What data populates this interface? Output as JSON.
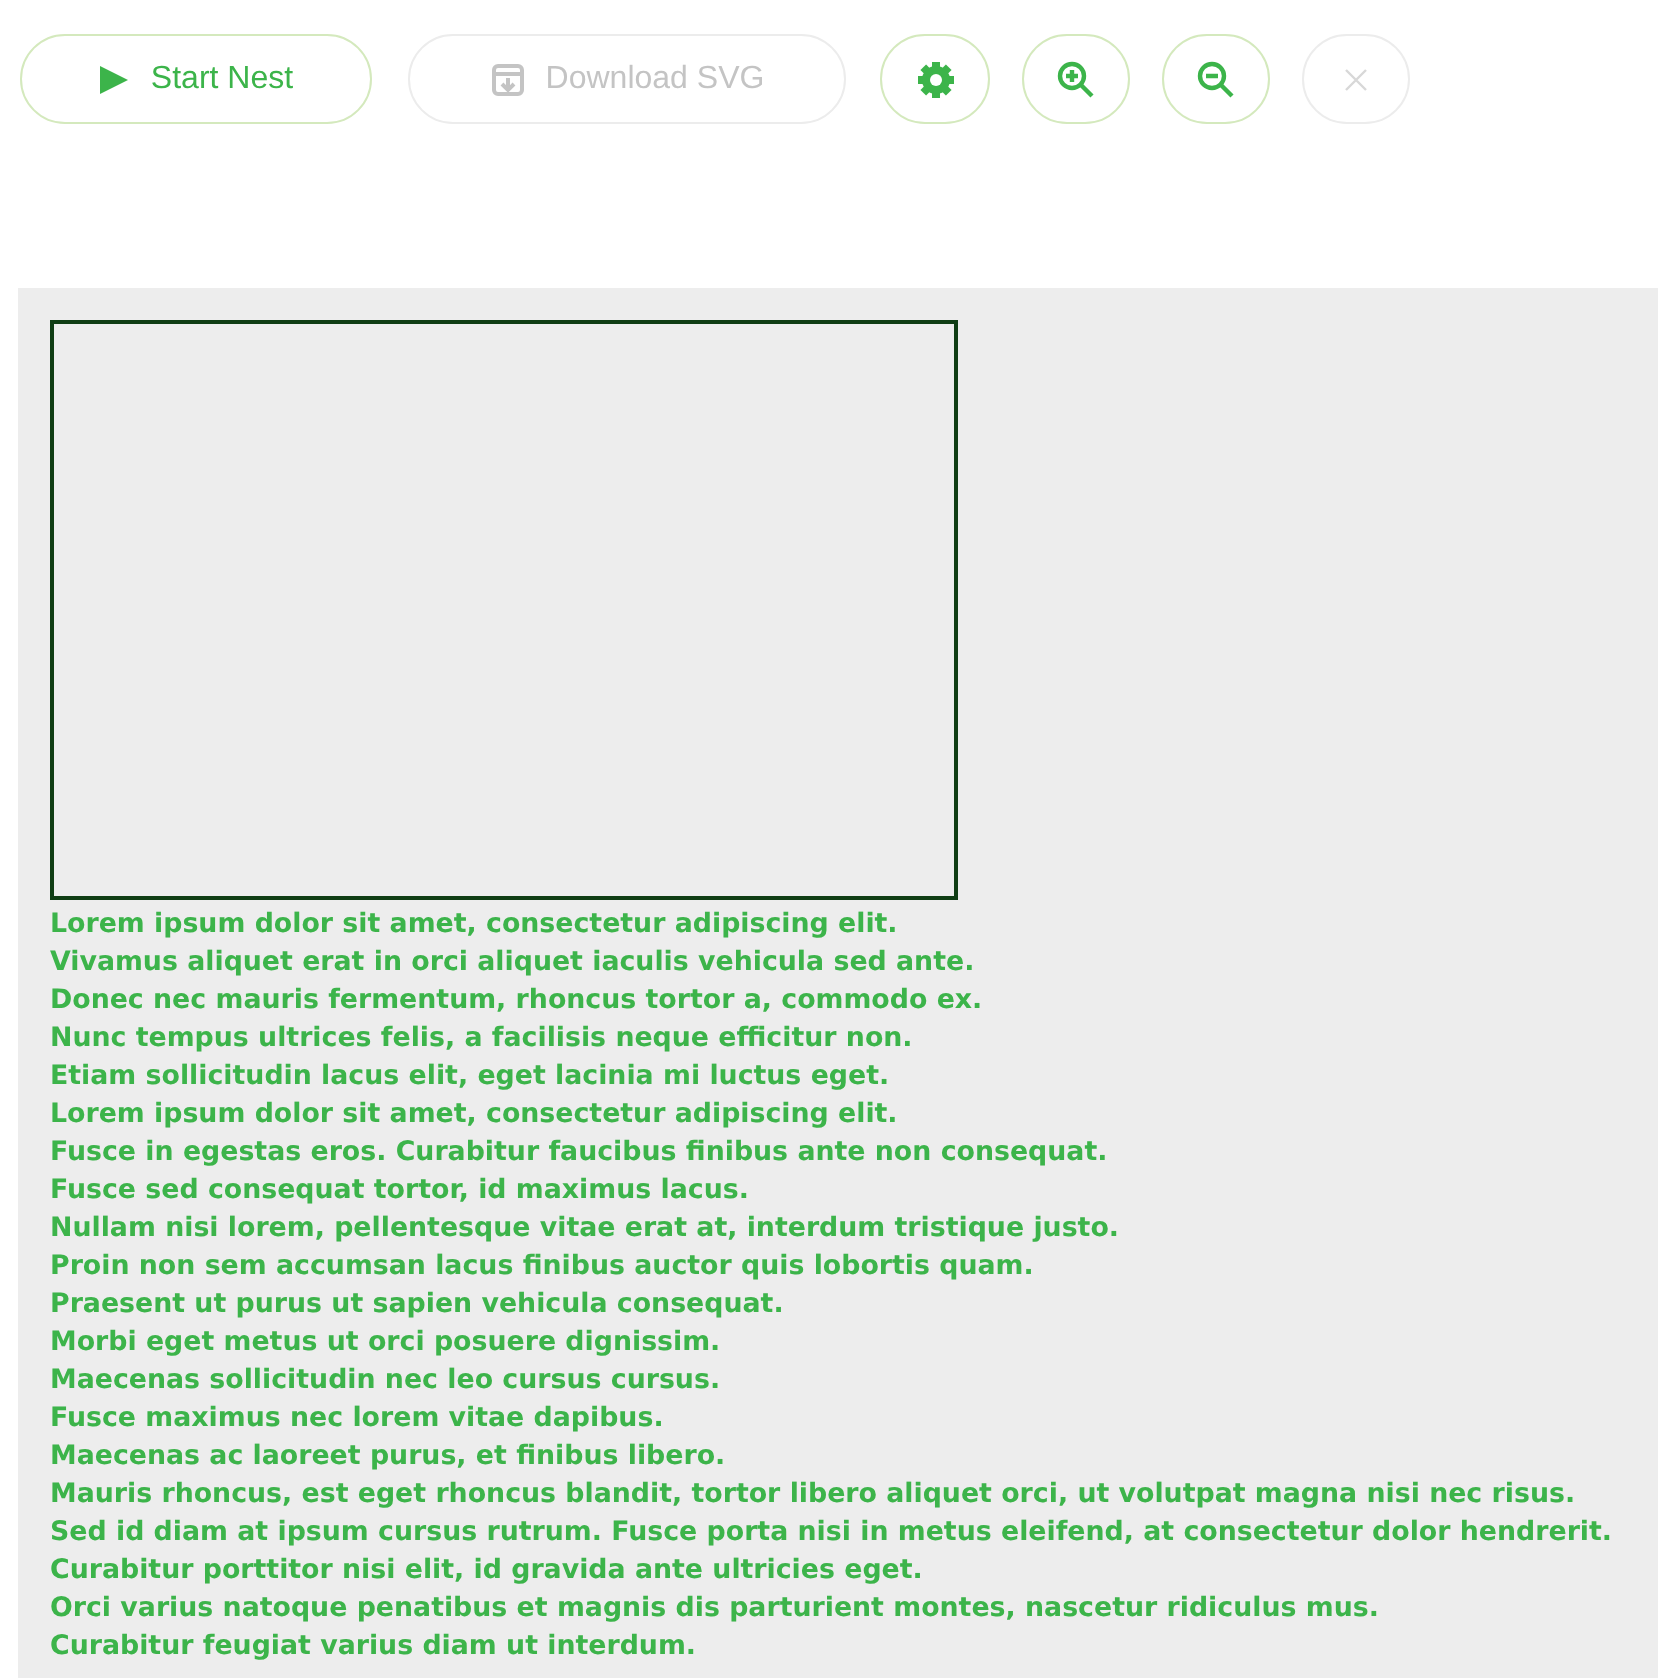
{
  "toolbar": [
    {
      "kind": "start",
      "label": "Start Nest",
      "disabled": false
    },
    {
      "kind": "download",
      "label": "Download SVG",
      "disabled": true
    },
    {
      "kind": "settings",
      "disabled": false
    },
    {
      "kind": "zoom-in",
      "disabled": false
    },
    {
      "kind": "zoom-out",
      "disabled": false
    },
    {
      "kind": "close",
      "disabled": true
    }
  ],
  "canvas": {
    "lines": [
      "Lorem ipsum dolor sit amet, consectetur adipiscing elit.",
      "Vivamus aliquet erat in orci aliquet iaculis vehicula sed ante.",
      "Donec nec mauris fermentum, rhoncus tortor a, commodo ex.",
      "Nunc tempus ultrices felis, a facilisis neque efficitur non.",
      "Etiam sollicitudin lacus elit, eget lacinia mi luctus eget.",
      "Lorem ipsum dolor sit amet, consectetur adipiscing elit.",
      "Fusce in egestas eros. Curabitur faucibus finibus ante non consequat.",
      "Fusce sed consequat tortor, id maximus lacus.",
      "Nullam nisi lorem, pellentesque vitae erat at, interdum tristique justo.",
      "Proin non sem accumsan lacus finibus auctor quis lobortis quam.",
      "Praesent ut purus ut sapien vehicula consequat.",
      "Morbi eget metus ut orci posuere dignissim.",
      "Maecenas sollicitudin nec leo cursus cursus.",
      "Fusce maximus nec lorem vitae dapibus.",
      "Maecenas ac laoreet purus, et finibus libero.",
      "Mauris rhoncus, est eget rhoncus blandit, tortor libero aliquet orci, ut volutpat magna nisi nec risus.",
      "Sed id diam at ipsum cursus rutrum. Fusce porta nisi in metus eleifend, at consectetur dolor hendrerit.",
      "Curabitur porttitor nisi elit, id gravida ante ultricies eget.",
      "Orci varius natoque penatibus et magnis dis parturient montes, nascetur ridiculus mus.",
      "Curabitur feugiat varius diam ut interdum."
    ]
  }
}
